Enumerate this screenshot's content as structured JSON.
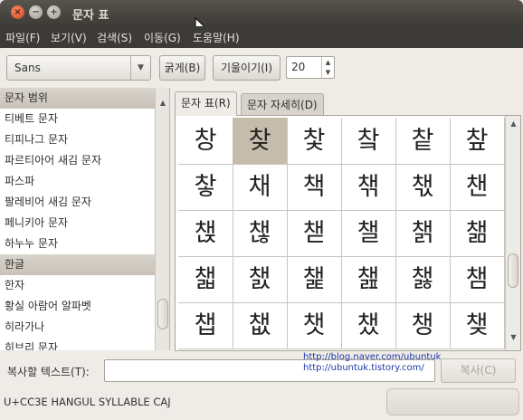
{
  "window": {
    "title": "문자 표",
    "buttons": {
      "close": "×",
      "minimize": "−",
      "maximize": "+"
    }
  },
  "menubar": [
    "파일(F)",
    "보기(V)",
    "검색(S)",
    "이동(G)",
    "도움말(H)"
  ],
  "toolbar": {
    "font": "Sans",
    "bold_label": "굵게(B)",
    "italic_label": "기울이기(I)",
    "size": "20"
  },
  "script_list": [
    {
      "label": "문자 범위",
      "header": true
    },
    {
      "label": "티베트 문자"
    },
    {
      "label": "티피나그 문자"
    },
    {
      "label": "파르티아어 새김 문자"
    },
    {
      "label": "파스파"
    },
    {
      "label": "팔레비어 새김 문자"
    },
    {
      "label": "페니키아 문자"
    },
    {
      "label": "하누누 문자"
    },
    {
      "label": "한글",
      "header": true
    },
    {
      "label": "한자"
    },
    {
      "label": "황실 아람어 알파벳"
    },
    {
      "label": "히라가나"
    },
    {
      "label": "히브리 문자"
    }
  ],
  "tabs": {
    "table": "문자 표(R)",
    "details": "문자 자세히(D)"
  },
  "grid": {
    "selected_index": 1,
    "chars": [
      "창",
      "찾",
      "찿",
      "챀",
      "챁",
      "챂",
      "챃",
      "채",
      "책",
      "챆",
      "챇",
      "챈",
      "챉",
      "챊",
      "챋",
      "챌",
      "챍",
      "챎",
      "챏",
      "챐",
      "챑",
      "챒",
      "챓",
      "챔",
      "챕",
      "챖",
      "챗",
      "챘",
      "챙",
      "챚"
    ]
  },
  "copy": {
    "label": "복사할 텍스트(T):",
    "value": "",
    "button": "복사(C)"
  },
  "overlay_urls": [
    "http://blog.naver.com/ubuntuk",
    "http://ubuntuk.tistory.com/"
  ],
  "status": "U+CC3E HANGUL SYLLABLE CAJ",
  "icons": {
    "arrow_down": "▼",
    "arrow_up": "▲",
    "cursor": "➤"
  }
}
